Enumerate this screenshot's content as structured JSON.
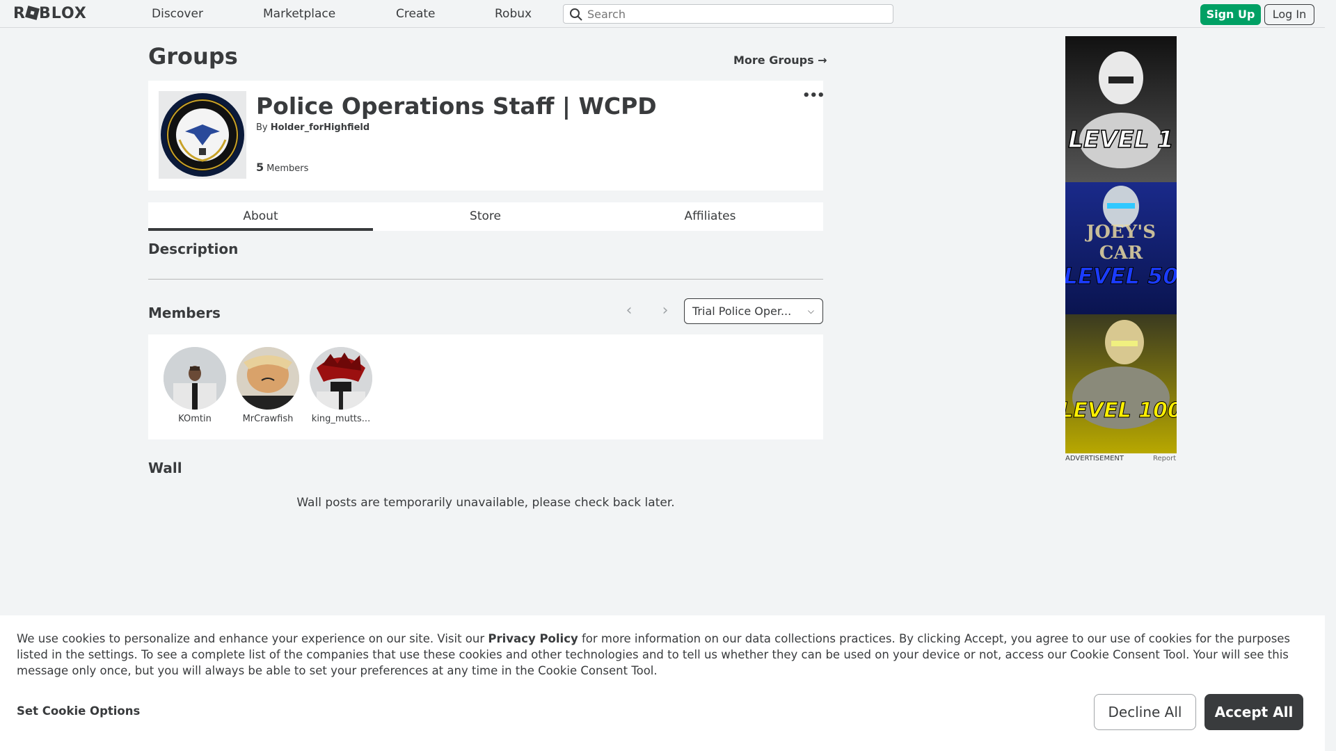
{
  "header": {
    "logo": "ROBLOX",
    "nav": [
      "Discover",
      "Marketplace",
      "Create",
      "Robux"
    ],
    "search_placeholder": "Search",
    "signup_label": "Sign Up",
    "login_label": "Log In"
  },
  "page": {
    "title": "Groups",
    "more_groups": "More Groups →"
  },
  "group": {
    "name": "Police Operations Staff | WCPD",
    "by_prefix": "By",
    "owner": "Holder_forHighfield",
    "member_count": "5",
    "members_label": "Members",
    "more_icon": "ellipsis-icon"
  },
  "tabs": [
    {
      "label": "About",
      "active": true
    },
    {
      "label": "Store",
      "active": false
    },
    {
      "label": "Affiliates",
      "active": false
    }
  ],
  "about": {
    "description_title": "Description",
    "members_title": "Members",
    "role_selected": "Trial Police Oper...",
    "members": [
      {
        "name": "KOmtin"
      },
      {
        "name": "MrCrawfish"
      },
      {
        "name": "king_mutts..."
      }
    ],
    "wall_title": "Wall",
    "wall_message": "Wall posts are temporarily unavailable, please check back later."
  },
  "ad": {
    "label": "ADVERTISEMENT",
    "report": "Report",
    "texts": [
      "LEVEL 1",
      "JOEY'S",
      "CAR",
      "LEVEL 50",
      "LEVEL 100"
    ]
  },
  "cookie": {
    "text_before": "We use cookies to personalize and enhance your experience on our site. Visit our ",
    "privacy_policy": "Privacy Policy",
    "text_after": " for more information on our data collections practices. By clicking Accept, you agree to our use of cookies for the purposes listed in the settings. To see a complete list of the companies that use these cookies and other technologies and to tell us whether they can be used on your device or not, access our Cookie Consent Tool. Your will see this message only once, but you will always be able to set your preferences at any time in the Cookie Consent Tool.",
    "set_options": "Set Cookie Options",
    "decline": "Decline All",
    "accept": "Accept All"
  },
  "colors": {
    "signup_green": "#00a064",
    "accept_dark": "#393b3d",
    "page_bg": "#f2f4f5"
  }
}
